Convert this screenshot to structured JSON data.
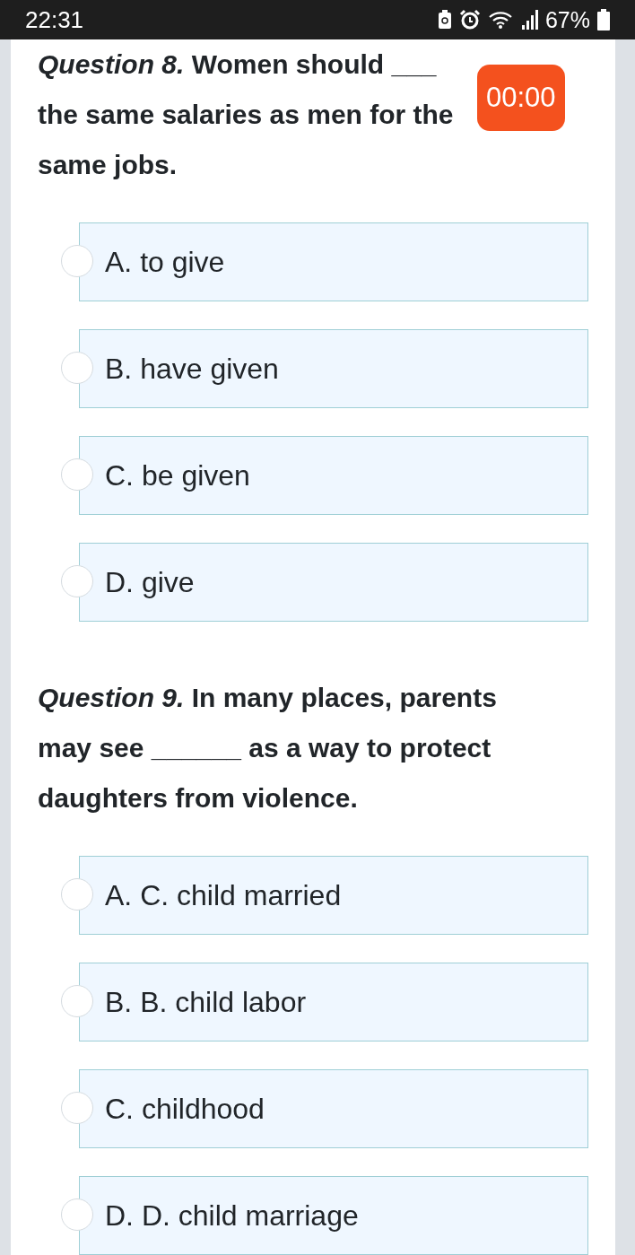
{
  "status_bar": {
    "time": "22:31",
    "battery": "67%"
  },
  "timer": "00:00",
  "questions": [
    {
      "text": "*Question 8.* Women should ___ the same salaries as men for the same jobs.",
      "options": [
        {
          "label": "A. to give",
          "selected": false
        },
        {
          "label": "B. have given",
          "selected": false
        },
        {
          "label": "C. be given",
          "selected": false
        },
        {
          "label": "D. give",
          "selected": false
        }
      ]
    },
    {
      "text": "*Question 9.* In many places, parents may see ______ as a way to protect daughters from violence.",
      "options": [
        {
          "label": "A. C. child married",
          "selected": false
        },
        {
          "label": "B. B. child labor",
          "selected": false
        },
        {
          "label": "C. childhood",
          "selected": false
        },
        {
          "label": "D. D. child marriage",
          "selected": false
        }
      ]
    }
  ]
}
